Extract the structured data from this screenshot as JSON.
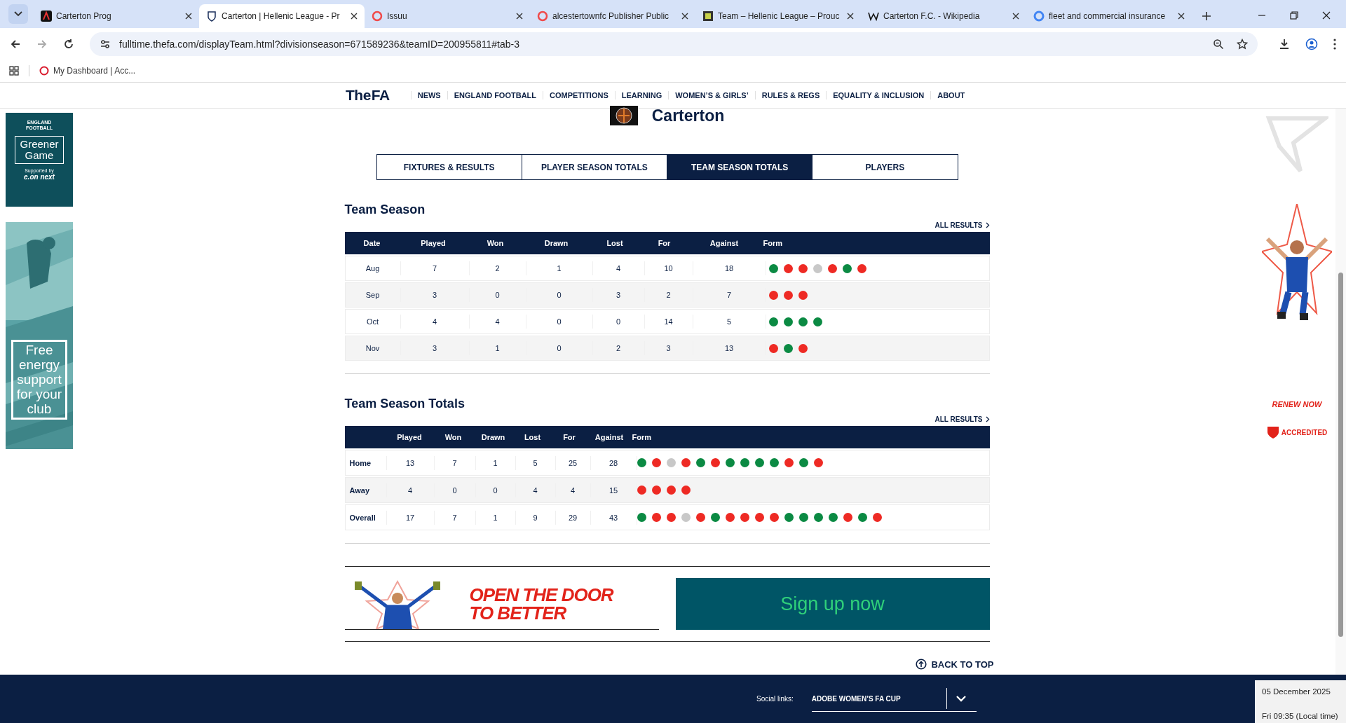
{
  "browser": {
    "tabs": [
      {
        "title": "Carterton Prog",
        "selected": false
      },
      {
        "title": "Carterton | Hellenic League - Pr",
        "selected": true
      },
      {
        "title": "Issuu",
        "selected": false
      },
      {
        "title": "alcestertownfc Publisher Public",
        "selected": false
      },
      {
        "title": "Team – Hellenic League – Prouc",
        "selected": false
      },
      {
        "title": "Carterton F.C. - Wikipedia",
        "selected": false
      },
      {
        "title": "fleet and commercial insurance",
        "selected": false
      }
    ],
    "url": "fulltime.thefa.com/displayTeam.html?divisionseason=671589236&teamID=200955811#tab-3",
    "bookmarks": [
      "My Dashboard | Acc..."
    ]
  },
  "site": {
    "logo_the": "The",
    "logo_fa": "FA",
    "nav": [
      "NEWS",
      "ENGLAND FOOTBALL",
      "COMPETITIONS",
      "LEARNING",
      "WOMEN’S & GIRLS’",
      "RULES & REGS",
      "EQUALITY & INCLUSION",
      "ABOUT"
    ]
  },
  "team": {
    "name": "Carterton"
  },
  "tabs": [
    {
      "label": "FIXTURES & RESULTS",
      "selected": false
    },
    {
      "label": "PLAYER SEASON TOTALS",
      "selected": false
    },
    {
      "label": "TEAM SEASON TOTALS",
      "selected": true
    },
    {
      "label": "PLAYERS",
      "selected": false
    }
  ],
  "sections": [
    {
      "kind": "by_month",
      "title": "Team Season",
      "all_results": "ALL RESULTS",
      "label_heading": "Date",
      "columns": [
        "Played",
        "Won",
        "Drawn",
        "Lost",
        "For",
        "Against"
      ],
      "form_heading": "Form",
      "rows": [
        {
          "label": "Aug",
          "values": [
            "7",
            "2",
            "1",
            "4",
            "10",
            "18"
          ],
          "form": [
            {
              "color": "#0b8a43"
            },
            {
              "color": "#ee2a24"
            },
            {
              "color": "#ee2a24"
            },
            {
              "color": "#c8c8c8"
            },
            {
              "color": "#ee2a24"
            },
            {
              "color": "#0b8a43"
            },
            {
              "color": "#ee2a24"
            }
          ]
        },
        {
          "label": "Sep",
          "values": [
            "3",
            "0",
            "0",
            "3",
            "2",
            "7"
          ],
          "form": [
            {
              "color": "#ee2a24"
            },
            {
              "color": "#ee2a24"
            },
            {
              "color": "#ee2a24"
            }
          ]
        },
        {
          "label": "Oct",
          "values": [
            "4",
            "4",
            "0",
            "0",
            "14",
            "5"
          ],
          "form": [
            {
              "color": "#0b8a43"
            },
            {
              "color": "#0b8a43"
            },
            {
              "color": "#0b8a43"
            },
            {
              "color": "#0b8a43"
            }
          ]
        },
        {
          "label": "Nov",
          "values": [
            "3",
            "1",
            "0",
            "2",
            "3",
            "13"
          ],
          "form": [
            {
              "color": "#ee2a24"
            },
            {
              "color": "#0b8a43"
            },
            {
              "color": "#ee2a24"
            }
          ]
        }
      ]
    },
    {
      "kind": "by_venue",
      "title": "Team Season Totals",
      "all_results": "ALL RESULTS",
      "columns": [
        "Played",
        "Won",
        "Drawn",
        "Lost",
        "For",
        "Against"
      ],
      "form_heading": "Form",
      "rows": [
        {
          "label": "Home",
          "values": [
            "13",
            "7",
            "1",
            "5",
            "25",
            "28"
          ],
          "form": [
            {
              "color": "#0b8a43"
            },
            {
              "color": "#ee2a24"
            },
            {
              "color": "#c8c8c8"
            },
            {
              "color": "#ee2a24"
            },
            {
              "color": "#0b8a43"
            },
            {
              "color": "#ee2a24"
            },
            {
              "color": "#0b8a43"
            },
            {
              "color": "#0b8a43"
            },
            {
              "color": "#0b8a43"
            },
            {
              "color": "#0b8a43"
            },
            {
              "color": "#ee2a24"
            },
            {
              "color": "#0b8a43"
            },
            {
              "color": "#ee2a24"
            }
          ]
        },
        {
          "label": "Away",
          "values": [
            "4",
            "0",
            "0",
            "4",
            "4",
            "15"
          ],
          "form": [
            {
              "color": "#ee2a24"
            },
            {
              "color": "#ee2a24"
            },
            {
              "color": "#ee2a24"
            },
            {
              "color": "#ee2a24"
            }
          ]
        },
        {
          "label": "Overall",
          "values": [
            "17",
            "7",
            "1",
            "9",
            "29",
            "43"
          ],
          "form": [
            {
              "color": "#0b8a43"
            },
            {
              "color": "#ee2a24"
            },
            {
              "color": "#ee2a24"
            },
            {
              "color": "#c8c8c8"
            },
            {
              "color": "#ee2a24"
            },
            {
              "color": "#0b8a43"
            },
            {
              "color": "#ee2a24"
            },
            {
              "color": "#ee2a24"
            },
            {
              "color": "#ee2a24"
            },
            {
              "color": "#ee2a24"
            },
            {
              "color": "#0b8a43"
            },
            {
              "color": "#0b8a43"
            },
            {
              "color": "#0b8a43"
            },
            {
              "color": "#0b8a43"
            },
            {
              "color": "#ee2a24"
            },
            {
              "color": "#0b8a43"
            },
            {
              "color": "#ee2a24"
            }
          ]
        }
      ]
    }
  ],
  "ads": {
    "greener": {
      "brand": "ENGLAND FOOTBALL",
      "title": "Greener Game",
      "supported": "Supported by",
      "sponsor": "e.on next"
    },
    "energy": {
      "text": "Free energy support for your club"
    },
    "renew": "RENEW NOW",
    "accredited": "ACCREDITED",
    "banner": "OPEN THE DOOR TO BETTER",
    "signup": "Sign up now"
  },
  "back_to_top": "BACK TO TOP",
  "footer": {
    "social_label": "Social links:",
    "select_value": "ADOBE WOMEN’S FA CUP"
  },
  "clock": {
    "date": "05 December 2025",
    "time": "Fri 09:35 (Local time)"
  }
}
